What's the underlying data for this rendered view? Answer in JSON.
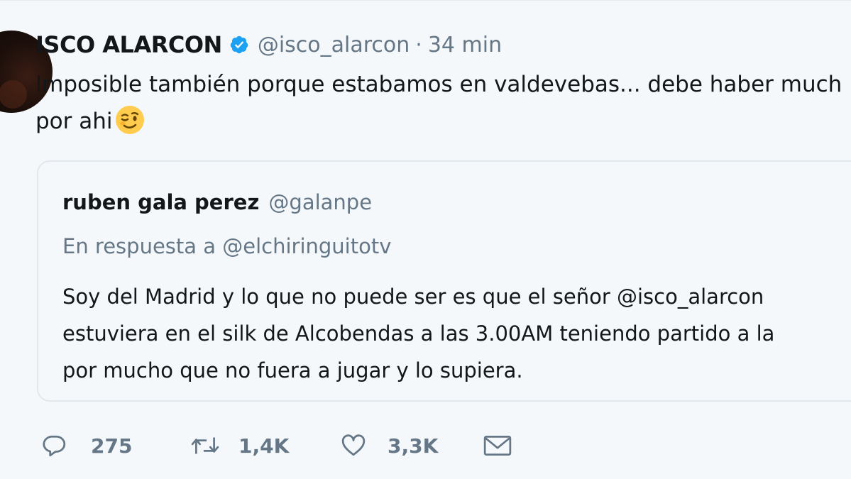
{
  "tweet": {
    "author_name": "ISCO ALARCON",
    "handle": "@isco_alarcon",
    "separator": "·",
    "time": "34 min",
    "text_line1": "Imposible también porque estabamos en valdevebas... debe haber much",
    "text_line2": "por ahi",
    "emoji": "winking-face"
  },
  "quote": {
    "author_name": "ruben gala perez",
    "handle": "@galanpe",
    "reply_to": "En respuesta a @elchiringuitotv",
    "text_line1": "Soy del Madrid y lo que no puede ser es que el señor @isco_alarcon",
    "text_line2": "estuviera en el silk de Alcobendas a las 3.00AM teniendo partido a la",
    "text_line3": "por mucho que no fuera a jugar y lo supiera."
  },
  "actions": {
    "reply_count": "275",
    "retweet_count": "1,4K",
    "like_count": "3,3K"
  },
  "icons": {
    "verified": "verified-badge-icon",
    "reply": "reply-bubble-icon",
    "retweet": "retweet-icon",
    "like": "heart-icon",
    "dm": "envelope-icon"
  },
  "colors": {
    "background": "#f5f8fa",
    "text": "#14171a",
    "muted": "#657786",
    "verified": "#1da1f2",
    "border": "#e1e8ed"
  }
}
